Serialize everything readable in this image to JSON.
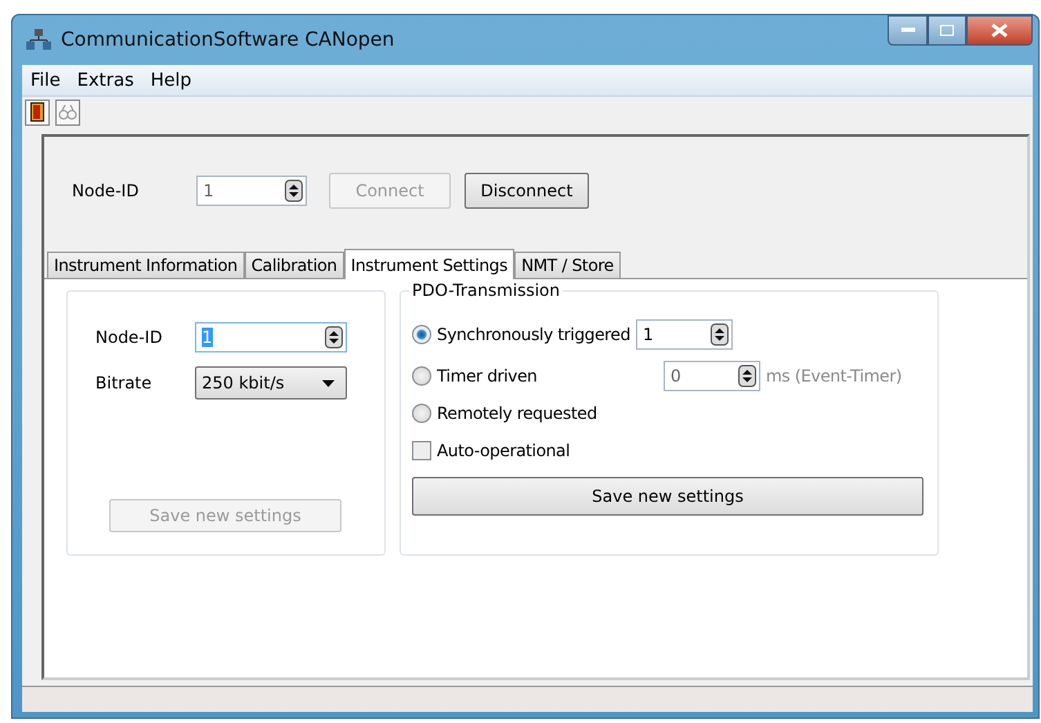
{
  "window": {
    "title": "CommunicationSoftware CANopen"
  },
  "menu": [
    {
      "label": "File"
    },
    {
      "label": "Extras"
    },
    {
      "label": "Help"
    }
  ],
  "connection": {
    "label": "Node-ID",
    "value": "1",
    "buttons": [
      {
        "label": "Connect",
        "disabled": true
      },
      {
        "label": "Disconnect",
        "disabled": false
      }
    ]
  },
  "tabs": [
    {
      "label": "Instrument Information",
      "selected": false
    },
    {
      "label": "Calibration",
      "selected": false
    },
    {
      "label": "Instrument Settings",
      "selected": true
    },
    {
      "label": "NMT / Store",
      "selected": false
    }
  ],
  "device_settings": {
    "node_id": {
      "label": "Node-ID",
      "value": "1"
    },
    "bitrate": {
      "label": "Bitrate",
      "value": "250 kbit/s"
    },
    "save_button": {
      "label": "Save new settings",
      "disabled": true
    }
  },
  "pdo_transmission": {
    "title": "PDO-Transmission",
    "modes": [
      {
        "label": "Synchronously triggered",
        "selected": true,
        "value": "1",
        "disabled": false
      },
      {
        "label": "Timer driven",
        "selected": false,
        "value": "0",
        "unit": "ms (Event-Timer)",
        "disabled": true
      },
      {
        "label": "Remotely requested",
        "selected": false
      }
    ],
    "auto_operational": {
      "label": "Auto-operational",
      "checked": false
    },
    "save_button": {
      "label": "Save new settings",
      "disabled": false
    }
  }
}
